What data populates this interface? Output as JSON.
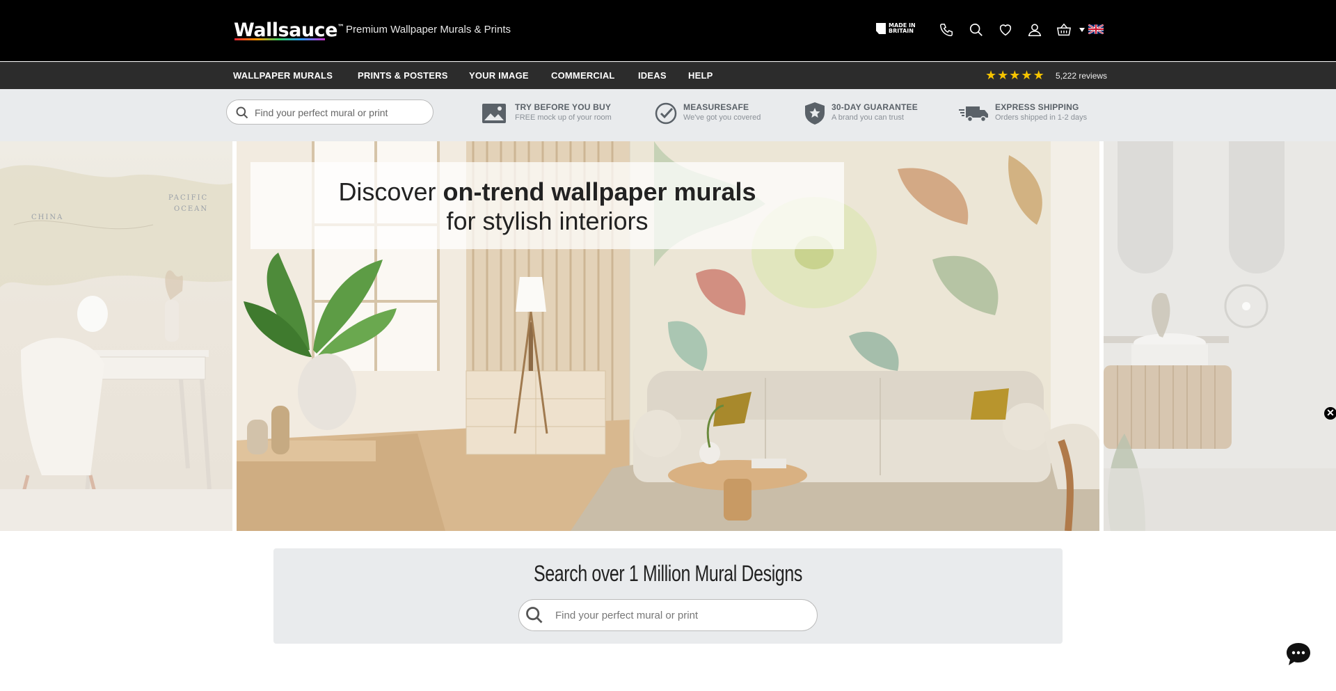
{
  "header": {
    "logo_text": "Wallsauce",
    "logo_mark": "™",
    "tagline": "Premium Wallpaper Murals & Prints",
    "made_in_line1": "MADE IN",
    "made_in_line2": "BRITAIN",
    "icons": [
      "phone-icon",
      "search-icon",
      "heart-icon",
      "user-icon",
      "basket-icon",
      "caret-down-icon",
      "uk-flag-icon"
    ]
  },
  "nav": {
    "items": [
      "WALLPAPER MURALS",
      "PRINTS & POSTERS",
      "YOUR IMAGE",
      "COMMERCIAL",
      "IDEAS",
      "HELP"
    ],
    "rating_stars": 5,
    "reviews": "5,222 reviews"
  },
  "usp": {
    "search_placeholder": "Find your perfect mural or print",
    "items": [
      {
        "title": "TRY BEFORE YOU BUY",
        "subtitle": "FREE mock up of your room",
        "icon": "image-icon"
      },
      {
        "title": "MEASURESAFE",
        "subtitle": "We've got you covered",
        "icon": "check-badge-icon"
      },
      {
        "title": "30-DAY GUARANTEE",
        "subtitle": "A brand you can trust",
        "icon": "shield-star-icon"
      },
      {
        "title": "EXPRESS SHIPPING",
        "subtitle": "Orders shipped in 1-2 days",
        "icon": "truck-icon"
      }
    ]
  },
  "hero": {
    "headline_prefix": "Discover ",
    "headline_bold": "on-trend wallpaper murals",
    "headline_line2": "for stylish interiors",
    "map_labels": [
      "CHINA",
      "PACIFIC",
      "OCEAN"
    ],
    "close_icon": "close-icon"
  },
  "search_section": {
    "heading": "Search over 1 Million Mural Designs",
    "placeholder": "Find your perfect mural or print"
  },
  "chat": {
    "icon": "chat-icon"
  },
  "colors": {
    "topbar": "#000000",
    "navbar": "#2c2c2c",
    "usp_bar": "#e9ebed",
    "star": "#f5c300"
  }
}
